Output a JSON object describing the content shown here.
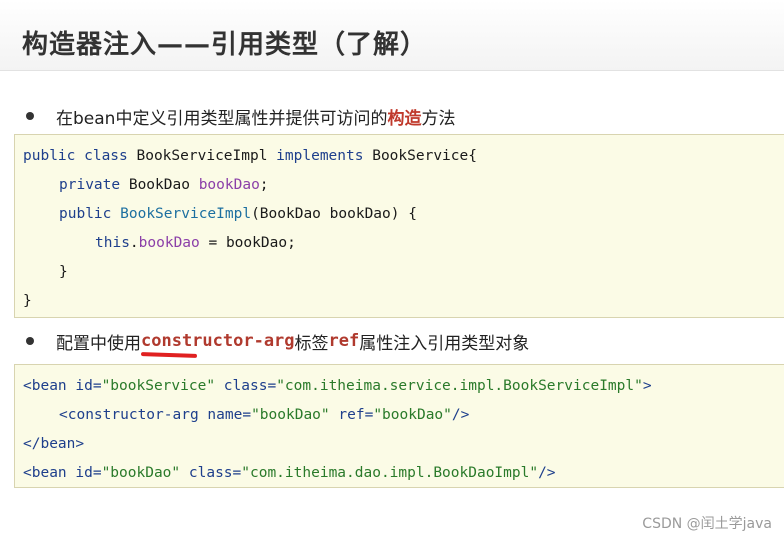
{
  "slide": {
    "title": "构造器注入——引用类型（了解）"
  },
  "bullet1": {
    "prefix": "在bean中定义引用类型属性并提供可访问的",
    "highlight": "构造",
    "suffix": "方法"
  },
  "code1": {
    "l1_a": "public class",
    "l1_b": " BookServiceImpl ",
    "l1_c": "implements",
    "l1_d": " BookService{",
    "l2_a": "private",
    "l2_b": " BookDao ",
    "l2_c": "bookDao",
    "l2_d": ";",
    "l3_a": "public",
    "l3_b": " ",
    "l3_c": "BookServiceImpl",
    "l3_d": "(BookDao bookDao) {",
    "l4_a": "this",
    "l4_b": ".",
    "l4_c": "bookDao",
    "l4_d": " = bookDao;",
    "l5": "}",
    "l6": "}"
  },
  "bullet2": {
    "prefix": "配置中使用",
    "code1": "constructor-arg",
    "middle": "标签",
    "code2": "ref",
    "suffix": "属性注入引用类型对象"
  },
  "code2": {
    "l1_a": "<bean",
    "l1_b": " id=",
    "l1_c": "\"bookService\"",
    "l1_d": " class=",
    "l1_e": "\"com.itheima.service.impl.BookServiceImpl\"",
    "l1_f": ">",
    "l2_a": "<constructor-arg",
    "l2_b": " name=",
    "l2_c": "\"bookDao\"",
    "l2_d": " ref=",
    "l2_e": "\"bookDao\"",
    "l2_f": "/>",
    "l3": "</bean>",
    "l4_a": "<bean",
    "l4_b": " id=",
    "l4_c": "\"bookDao\"",
    "l4_d": " class=",
    "l4_e": "\"com.itheima.dao.impl.BookDaoImpl\"",
    "l4_f": "/>"
  },
  "watermark": "CSDN @闰土学java"
}
